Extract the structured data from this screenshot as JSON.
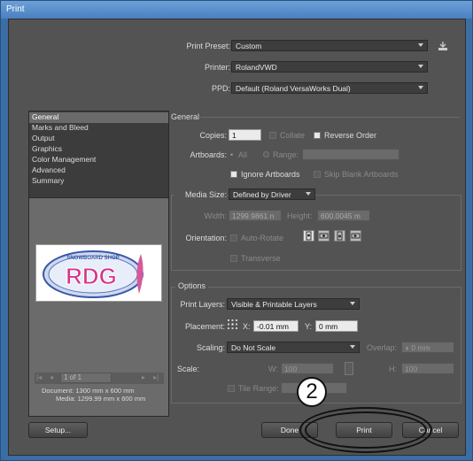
{
  "window": {
    "title": "Print"
  },
  "top": {
    "preset_label": "Print Preset:",
    "preset_value": "Custom",
    "printer_label": "Printer:",
    "printer_value": "RolandVWD",
    "ppd_label": "PPD:",
    "ppd_value": "Default (Roland VersaWorks Dual)"
  },
  "categories": [
    "General",
    "Marks and Bleed",
    "Output",
    "Graphics",
    "Color Management",
    "Advanced",
    "Summary"
  ],
  "selected_category": "General",
  "general": {
    "section_title": "General",
    "copies_label": "Copies:",
    "copies_value": "1",
    "collate_label": "Collate",
    "reverse_label": "Reverse Order",
    "artboards_label": "Artboards:",
    "all_label": "All",
    "range_label": "Range:",
    "ignore_label": "Ignore Artboards",
    "skip_label": "Skip Blank Artboards",
    "media_size_label": "Media Size:",
    "media_size_value": "Defined by Driver",
    "width_label": "Width:",
    "width_value": "1299.9861 n",
    "height_label": "Height:",
    "height_value": "600.0045 m",
    "orientation_label": "Orientation:",
    "autorotate_label": "Auto-Rotate",
    "transverse_label": "Transverse"
  },
  "options": {
    "section_title": "Options",
    "print_layers_label": "Print Layers:",
    "print_layers_value": "Visible & Printable Layers",
    "placement_label": "Placement:",
    "x_label": "X:",
    "x_value": "-0.01 mm",
    "y_label": "Y:",
    "y_value": "0 mm",
    "scaling_label": "Scaling:",
    "scaling_value": "Do Not Scale",
    "overlap_label": "Overlap:",
    "overlap_value": "0 mm",
    "scale_label": "Scale:",
    "w_label": "W:",
    "w_value": "100",
    "h_label": "H:",
    "h_value": "100",
    "tile_range_label": "Tile Range:"
  },
  "preview": {
    "logo_top_text": "SNOWBOARD SHOP",
    "logo_text": "RDG",
    "page_value": "1 of 1",
    "document_text": "Document: 1300 mm x 600 mm",
    "media_text": "Media: 1299.99 mm x 600 mm"
  },
  "buttons": {
    "setup": "Setup...",
    "done": "Done",
    "print": "Print",
    "cancel": "Cancel"
  },
  "annotation": {
    "step_number": "2"
  }
}
